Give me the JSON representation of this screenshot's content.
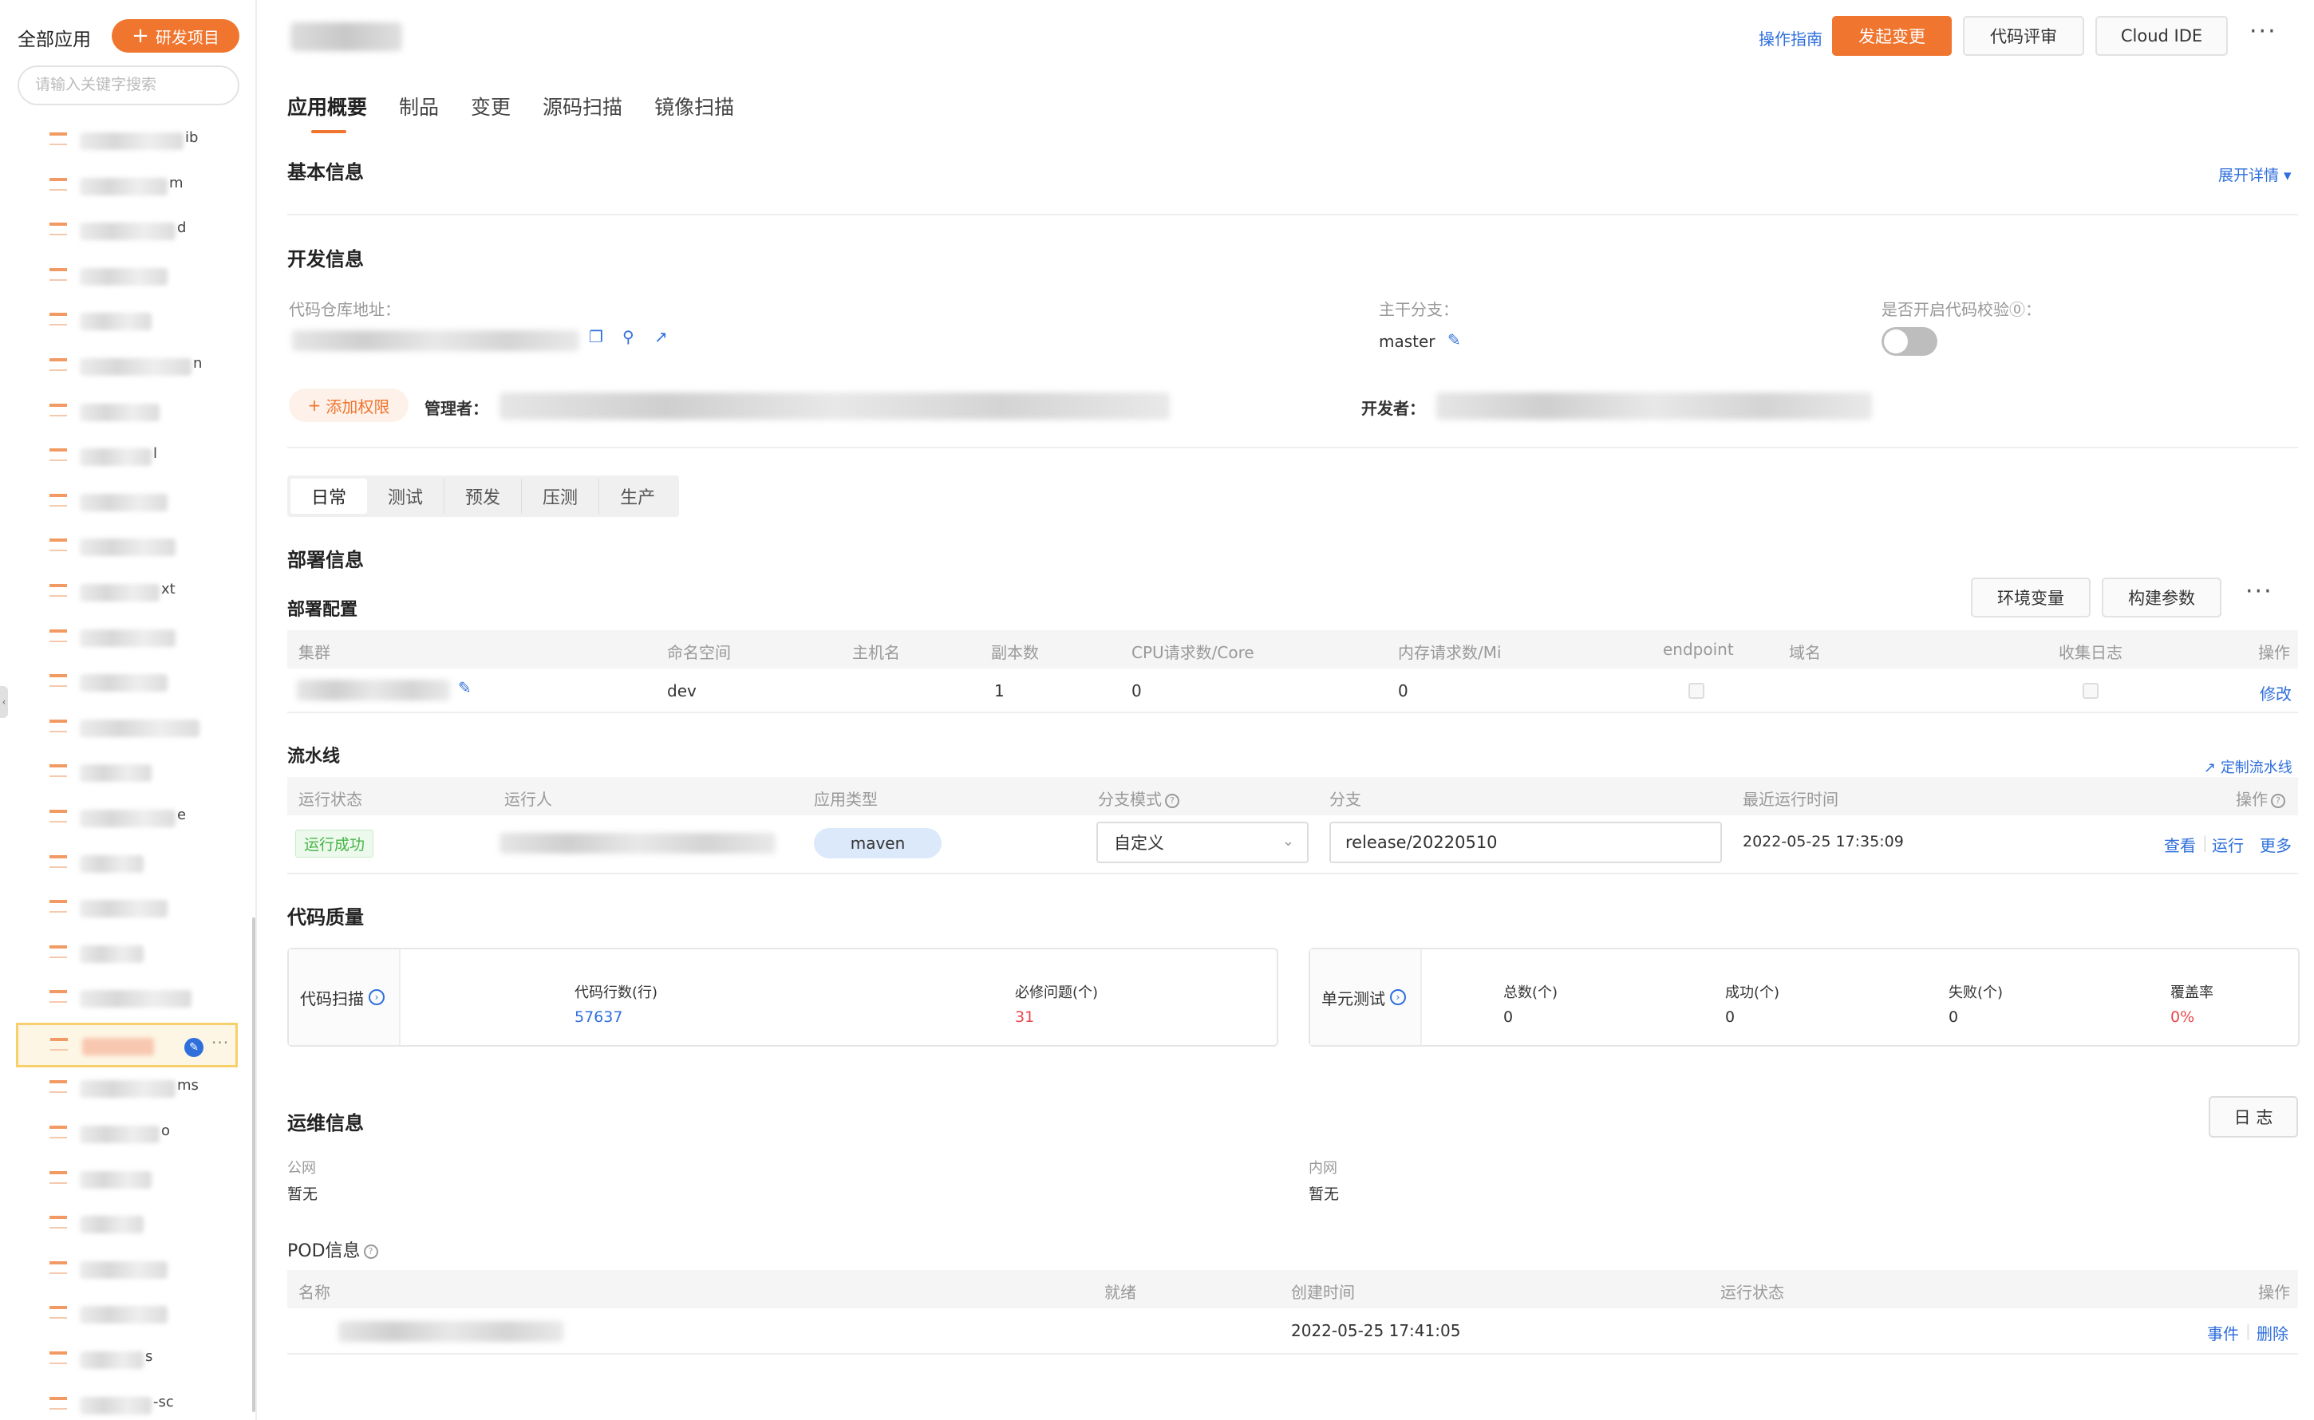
{
  "sidebar": {
    "title": "全部应用",
    "new_button": "研发项目",
    "search_placeholder": "请输入关键字搜索",
    "item_tails": [
      "ib",
      "m",
      "d",
      "",
      "",
      "n",
      "",
      "l",
      "",
      "",
      "xt",
      "",
      "",
      "",
      "",
      "e",
      "",
      "",
      "",
      "",
      "",
      "ms",
      "o",
      "",
      "",
      "",
      "",
      "s",
      "-sc"
    ]
  },
  "topbar": {
    "guide": "操作指南",
    "primary_action": "发起变更",
    "code_review": "代码评审",
    "cloud_ide": "Cloud IDE",
    "more": "···"
  },
  "tabs": [
    "应用概要",
    "制品",
    "变更",
    "源码扫描",
    "镜像扫描"
  ],
  "basic_info": {
    "title": "基本信息",
    "expand": "展开详情 ▾"
  },
  "dev_info": {
    "title": "开发信息",
    "repo_label": "代码仓库地址：",
    "branch_label": "主干分支：",
    "branch_value": "master",
    "code_check_label": "是否开启代码校验⓪：",
    "add_permission": "添加权限",
    "admin_label": "管理者：",
    "developer_label": "开发者："
  },
  "env_tabs": [
    "日常",
    "测试",
    "预发",
    "压测",
    "生产"
  ],
  "deploy": {
    "title": "部署信息",
    "config_title": "部署配置",
    "env_vars_button": "环境变量",
    "build_params_button": "构建参数",
    "columns": [
      "集群",
      "命名空间",
      "主机名",
      "副本数",
      "CPU请求数/Core",
      "内存请求数/Mi",
      "endpoint",
      "域名",
      "收集日志",
      "操作"
    ],
    "row": {
      "namespace": "dev",
      "replicas": "1",
      "cpu": "0",
      "memory": "0",
      "action": "修改"
    }
  },
  "pipeline": {
    "title": "流水线",
    "customize": "定制流水线",
    "columns": [
      "运行状态",
      "运行人",
      "应用类型",
      "分支模式",
      "分支",
      "最近运行时间",
      "操作"
    ],
    "row": {
      "status": "运行成功",
      "app_type": "maven",
      "branch_mode": "自定义",
      "branch": "release/20220510",
      "last_run": "2022-05-25 17:35:09",
      "actions": [
        "查看",
        "运行",
        "更多"
      ]
    }
  },
  "quality": {
    "title": "代码质量",
    "scan": {
      "label": "代码扫描",
      "metrics": [
        {
          "label": "代码行数(行)",
          "value": "57637",
          "color": "#2f6fdc"
        },
        {
          "label": "必修问题(个)",
          "value": "31",
          "color": "#e8474b"
        }
      ]
    },
    "unit_test": {
      "label": "单元测试",
      "metrics": [
        {
          "label": "总数(个)",
          "value": "0",
          "color": "#333333"
        },
        {
          "label": "成功(个)",
          "value": "0",
          "color": "#333333"
        },
        {
          "label": "失败(个)",
          "value": "0",
          "color": "#333333"
        },
        {
          "label": "覆盖率",
          "value": "0%",
          "color": "#e8474b"
        }
      ]
    }
  },
  "ops": {
    "title": "运维信息",
    "log_button": "日 志",
    "public_label": "公网",
    "public_value": "暂无",
    "private_label": "内网",
    "private_value": "暂无"
  },
  "pod": {
    "title": "POD信息",
    "columns": [
      "名称",
      "就绪",
      "创建时间",
      "运行状态",
      "操作"
    ],
    "row": {
      "created": "2022-05-25 17:41:05",
      "actions": [
        "事件",
        "删除"
      ]
    }
  },
  "colors": {
    "accent": "#f0752e",
    "link": "#2f6fdc",
    "success": "#46b446",
    "danger": "#e8474b"
  }
}
